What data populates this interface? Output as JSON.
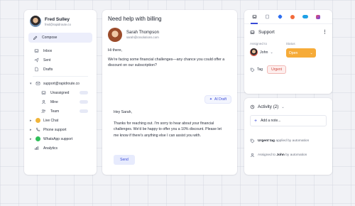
{
  "user": {
    "name": "Fred Sulley",
    "email": "fred@rapidroute.co"
  },
  "sidebar": {
    "compose": "Compose",
    "folders": [
      {
        "label": "Inbox",
        "icon": "inbox-icon"
      },
      {
        "label": "Sent",
        "icon": "send-icon"
      },
      {
        "label": "Drafts",
        "icon": "drafts-icon"
      }
    ],
    "account": "support@rapidroute.co",
    "account_items": [
      {
        "label": "Unassigned",
        "icon": "inbox-icon"
      },
      {
        "label": "Mine",
        "icon": "user-icon"
      },
      {
        "label": "Team",
        "icon": "team-icon"
      }
    ],
    "channels": [
      {
        "label": "Live Chat",
        "icon": "org-icon"
      },
      {
        "label": "Phone support",
        "icon": "phone-icon"
      },
      {
        "label": "WhatsApp support",
        "icon": "whatsapp-icon"
      }
    ],
    "analytics": "Analytics"
  },
  "main": {
    "title": "Need help with billing",
    "sender": {
      "name": "Sarah Thompson",
      "email": "sarah@cssolutions.com"
    },
    "message": {
      "greeting": "Hi there,",
      "body": "We're facing some financial challenges—any chance you could offer a discount on our subscription?"
    },
    "ai_draft_label": "AI Draft",
    "reply": {
      "greeting": "Hey Sarah,",
      "body": "Thanks for reaching out. I'm sorry to hear about your financial challenges. We'd be happy to offer you a 10% discount. Please let me know if there's anything else I can assist you with."
    },
    "send_label": "Send"
  },
  "panel": {
    "title": "Support",
    "assigned_label": "Assigned to",
    "assignee": "John",
    "status_label": "Status",
    "status_value": "Open",
    "tag_label": "Tag",
    "tag_value": "Urgent",
    "activity_title": "Activity (2)",
    "add_note": "Add a note...",
    "log": [
      {
        "strong": "Urgent tag",
        "rest": " applied by automation"
      },
      {
        "pre": "Assigned to ",
        "strong": "John",
        "rest": " by automation"
      }
    ]
  },
  "colors": {
    "accent": "#3a4bd8",
    "status": "#f6ab38",
    "urgent": "#d0463c"
  }
}
